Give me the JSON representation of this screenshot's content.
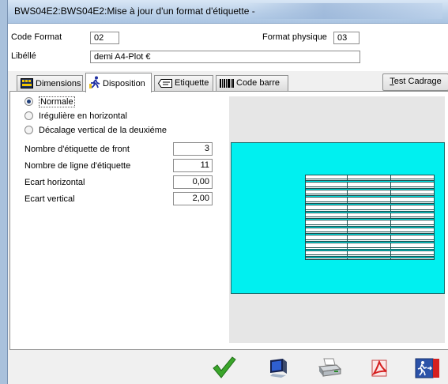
{
  "window": {
    "title": "BWS04E2:BWS04E2:Mise à jour d'un format d'étiquette -"
  },
  "header": {
    "code_format_label": "Code Format",
    "code_format_value": "02",
    "format_physique_label": "Format physique",
    "format_physique_value": "03",
    "libelle_label": "Libéllé",
    "libelle_value": "demi A4-Plot €"
  },
  "tabs": [
    {
      "label": "Dimensions",
      "icon": "dimensions-icon"
    },
    {
      "label": "Disposition",
      "icon": "runner-icon"
    },
    {
      "label": "Etiquette",
      "icon": "label-icon"
    },
    {
      "label": "Code barre",
      "icon": "barcode-icon"
    }
  ],
  "test_cadrage": {
    "first": "T",
    "rest": "est Cadrage"
  },
  "disposition": {
    "radios": [
      {
        "label": "Normale",
        "checked": true
      },
      {
        "label": "Irégulière en horizontal",
        "checked": false
      },
      {
        "label": "Décalage vertical de la deuxiéme",
        "checked": false
      }
    ],
    "fields": [
      {
        "label": "Nombre d'étiquette de front",
        "value": "3"
      },
      {
        "label": "Nombre de ligne d'étiquette",
        "value": "11"
      },
      {
        "label": "Ecart horizontal",
        "value": "0,00"
      },
      {
        "label": "Ecart vertical",
        "value": "2,00"
      }
    ]
  },
  "colors": {
    "sheet": "#00f0f0",
    "preview_bg": "#e6e6e6",
    "validate": "#3aa52a",
    "exit": "#d42020"
  },
  "toolbar": [
    "validate-check-icon",
    "computer-monitor-icon",
    "printer-icon",
    "pdf-icon",
    "exit-door-icon"
  ]
}
